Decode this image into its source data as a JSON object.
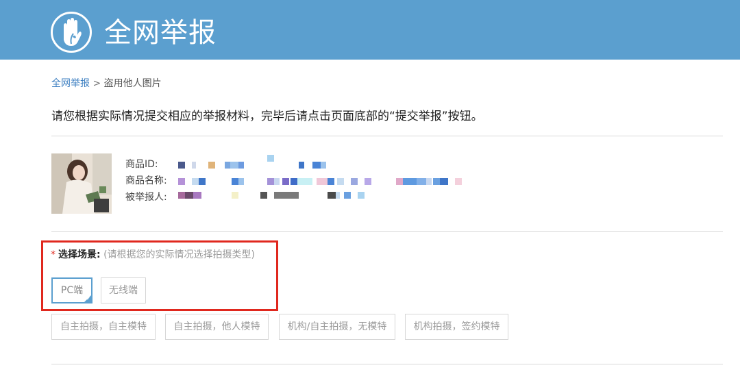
{
  "header": {
    "title": "全网举报",
    "logo_icon": "hand-leaf-icon",
    "bg_color": "#5b9fcf"
  },
  "breadcrumb": {
    "home": "全网举报",
    "separator": ">",
    "current": "盗用他人图片"
  },
  "instruction": "请您根据实际情况提交相应的举报材料，完毕后请点击页面底部的“提交举报”按钮。",
  "product": {
    "labels": {
      "id": "商品ID:",
      "name": "商品名称:",
      "reported": "被举报人:"
    }
  },
  "scene": {
    "required_mark": "*",
    "label": "选择场景:",
    "hint": "(请根据您的实际情况选择拍摄类型)",
    "platforms": [
      {
        "label": "PC端",
        "selected": true
      },
      {
        "label": "无线端",
        "selected": false
      }
    ],
    "shoot_types": [
      {
        "label": "自主拍摄，自主模特"
      },
      {
        "label": "自主拍摄，他人模特"
      },
      {
        "label": "机构/自主拍摄，无模特"
      },
      {
        "label": "机构拍摄，签约模特"
      }
    ]
  },
  "colors": {
    "accent": "#5b9fcf",
    "link": "#3d7fc1",
    "highlight_frame": "#e0281e"
  }
}
